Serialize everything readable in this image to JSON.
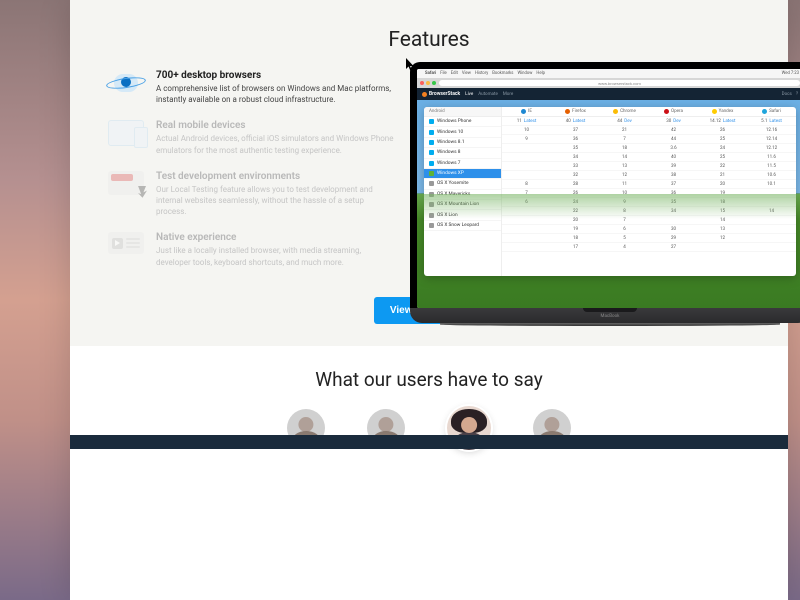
{
  "features_section": {
    "title": "Features",
    "items": [
      {
        "title": "700+ desktop browsers",
        "desc": "A comprehensive list of browsers on Windows and Mac platforms, instantly available on a robust cloud infrastructure.",
        "active": true
      },
      {
        "title": "Real mobile devices",
        "desc": "Actual Android devices, official iOS simulators and Windows Phone emulators for the most authentic testing experience.",
        "active": false
      },
      {
        "title": "Test development environments",
        "desc": "Our Local Testing feature allows you to test development and internal websites seamlessly, without the hassle of a setup process.",
        "active": false
      },
      {
        "title": "Native experience",
        "desc": "Just like a locally installed browser, with media streaming, developer tools, keyboard shortcuts, and much more.",
        "active": false
      }
    ],
    "cta_label": "View all features"
  },
  "laptop": {
    "model_label": "MacBook",
    "mac_menu": [
      "Safari",
      "File",
      "Edit",
      "View",
      "History",
      "Bookmarks",
      "Window",
      "Help"
    ],
    "mac_right": [
      "Wed 7:23"
    ],
    "address_bar": "www.browserstack.com",
    "app_brand": "BrowserStack",
    "app_nav": [
      "Live",
      "Automate",
      "More"
    ],
    "app_right": [
      "Docs",
      "?"
    ],
    "os_category_mobile": "Android",
    "os_list": [
      {
        "label": "Windows Phone",
        "ic": "win"
      },
      {
        "label": "Windows 10",
        "ic": "win"
      },
      {
        "label": "Windows 8.1",
        "ic": "win"
      },
      {
        "label": "Windows 8",
        "ic": "win"
      },
      {
        "label": "Windows 7",
        "ic": "win"
      },
      {
        "label": "Windows XP",
        "ic": "winxp",
        "selected": true
      },
      {
        "label": "OS X Yosemite",
        "ic": "osx"
      },
      {
        "label": "OS X Mavericks",
        "ic": "osx"
      },
      {
        "label": "OS X Mountain Lion",
        "ic": "osx"
      },
      {
        "label": "OS X Lion",
        "ic": "osx"
      },
      {
        "label": "OS X Snow Leopard",
        "ic": "osx"
      }
    ],
    "browser_columns": [
      {
        "label": "IE",
        "ic": "ie"
      },
      {
        "label": "Firefox",
        "ic": "ff"
      },
      {
        "label": "Chrome",
        "ic": "ch"
      },
      {
        "label": "Opera",
        "ic": "op"
      },
      {
        "label": "Yandex",
        "ic": "yx"
      },
      {
        "label": "Safari",
        "ic": "sf"
      }
    ],
    "browser_rows": [
      [
        "11 Latest",
        "40 Latest",
        "44 Dev",
        "30 Dev",
        "14.12 Latest",
        "5.1 Latest"
      ],
      [
        "10",
        "37",
        "21",
        "42",
        "26",
        "12.16"
      ],
      [
        "9",
        "36",
        "7",
        "44",
        "25",
        "12.14"
      ],
      [
        "",
        "35",
        "18",
        "3.6",
        "24",
        "12.12"
      ],
      [
        "",
        "34",
        "14",
        "40",
        "25",
        "11.6"
      ],
      [
        "",
        "33",
        "13",
        "39",
        "22",
        "11.5"
      ],
      [
        "",
        "32",
        "12",
        "38",
        "21",
        "10.6"
      ],
      [
        "8",
        "28",
        "11",
        "37",
        "20",
        "10.1"
      ],
      [
        "7",
        "26",
        "10",
        "36",
        "19",
        ""
      ],
      [
        "6",
        "24",
        "9",
        "35",
        "18",
        ""
      ],
      [
        "",
        "22",
        "8",
        "34",
        "15",
        "14"
      ],
      [
        "",
        "20",
        "7",
        "",
        "14",
        ""
      ],
      [
        "",
        "19",
        "6",
        "30",
        "13",
        ""
      ],
      [
        "",
        "18",
        "5",
        "29",
        "12",
        ""
      ],
      [
        "",
        "17",
        "4",
        "27",
        "",
        ""
      ]
    ]
  },
  "testimonials": {
    "title": "What our users have to say"
  }
}
